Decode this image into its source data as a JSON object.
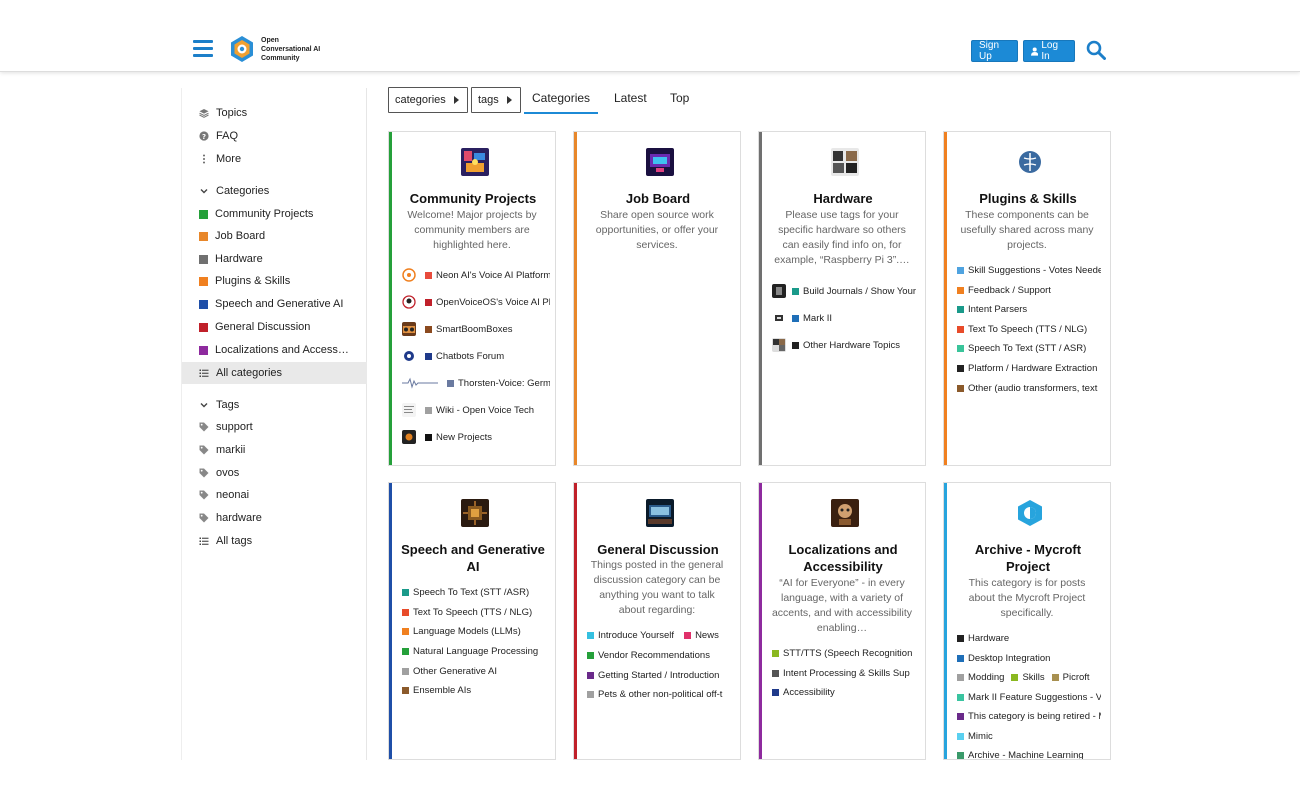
{
  "header": {
    "logo_text": [
      "Open",
      "Conversational AI",
      "Community"
    ],
    "signup_label": "Sign Up",
    "login_label": "Log In"
  },
  "sidebar": {
    "nav": [
      {
        "label": "Topics",
        "icon": "layers-icon"
      },
      {
        "label": "FAQ",
        "icon": "question-icon"
      },
      {
        "label": "More",
        "icon": "ellipsis-vertical-icon"
      }
    ],
    "categories_heading": "Categories",
    "categories": [
      {
        "label": "Community Projects",
        "color": "#25a03a"
      },
      {
        "label": "Job Board",
        "color": "#e8872a"
      },
      {
        "label": "Hardware",
        "color": "#707070"
      },
      {
        "label": "Plugins & Skills",
        "color": "#f08020"
      },
      {
        "label": "Speech and Generative AI",
        "color": "#1f4fa8"
      },
      {
        "label": "General Discussion",
        "color": "#c0202a"
      },
      {
        "label": "Localizations and Accessi…",
        "color": "#8e2a9e"
      }
    ],
    "all_categories": "All categories",
    "tags_heading": "Tags",
    "tags": [
      "support",
      "markii",
      "ovos",
      "neonai",
      "hardware"
    ],
    "all_tags": "All tags"
  },
  "nav": {
    "categories_dropdown": "categories",
    "tags_dropdown": "tags",
    "tabs": [
      "Categories",
      "Latest",
      "Top"
    ]
  },
  "cards": [
    {
      "title": "Community Projects",
      "color": "#25a03a",
      "description": "Welcome! Major projects by community members are highlighted here.",
      "subs": [
        {
          "label": "Neon AI's Voice AI Platform",
          "color": "#e84b3c"
        },
        {
          "label": "OpenVoiceOS's Voice AI Platform",
          "color": "#c0202a"
        },
        {
          "label": "SmartBoomBoxes",
          "color": "#8b4a1f"
        },
        {
          "label": "Chatbots Forum",
          "color": "#1f3a8a"
        },
        {
          "label": "Thorsten-Voice: German",
          "color": "#6a7aa0"
        },
        {
          "label": "Wiki - Open Voice Tech",
          "color": "#a0a0a0"
        },
        {
          "label": "New Projects",
          "color": "#111111"
        }
      ]
    },
    {
      "title": "Job Board",
      "color": "#e8872a",
      "description": "Share open source work opportunities, or offer your services.",
      "subs": []
    },
    {
      "title": "Hardware",
      "color": "#707070",
      "description": "Please use tags for your specific hardware so others can easily find info on, for example, “Raspberry Pi 3”.…",
      "subs": [
        {
          "label": "Build Journals / Show Your",
          "color": "#1a9a8a"
        },
        {
          "label": "Mark II",
          "color": "#1f6fb8"
        },
        {
          "label": "Other Hardware Topics",
          "color": "#222222"
        }
      ]
    },
    {
      "title": "Plugins & Skills",
      "color": "#f08020",
      "description": "These components can be usefully shared across many projects.",
      "subs": [
        {
          "label": "Skill Suggestions - Votes Needed",
          "color": "#4fa3e0"
        },
        {
          "label": "Feedback / Support",
          "color": "#f08020"
        },
        {
          "label": "Intent Parsers",
          "color": "#1a9a8a"
        },
        {
          "label": "Text To Speech (TTS / NLG)",
          "color": "#e84b2a"
        },
        {
          "label": "Speech To Text (STT / ASR)",
          "color": "#3ac49a"
        },
        {
          "label": "Platform / Hardware Extraction",
          "color": "#222222"
        },
        {
          "label": "Other (audio transformers, text",
          "color": "#8b5a2b"
        }
      ]
    },
    {
      "title": "Speech and Generative AI",
      "color": "#1f4fa8",
      "description": "",
      "subs": [
        {
          "label": "Speech To Text (STT /ASR)",
          "color": "#1a9a8a"
        },
        {
          "label": "Text To Speech (TTS / NLG)",
          "color": "#e84b2a"
        },
        {
          "label": "Language Models (LLMs)",
          "color": "#f08020"
        },
        {
          "label": "Natural Language Processing",
          "color": "#25a03a"
        },
        {
          "label": "Other Generative AI",
          "color": "#a0a0a0"
        },
        {
          "label": "Ensemble AIs",
          "color": "#8b5a2b"
        }
      ]
    },
    {
      "title": "General Discussion",
      "color": "#c0202a",
      "description": "Things posted in the general discussion category can be anything you want to talk about regarding:",
      "subs": [
        {
          "label": "Introduce Yourself",
          "color": "#35c0e0"
        },
        {
          "label": "News",
          "color": "#e0306a"
        },
        {
          "label": "Vendor Recommendations",
          "color": "#25a03a"
        },
        {
          "label": "Getting Started / Introduction",
          "color": "#6a2a8a"
        },
        {
          "label": "Pets & other non-political off-t",
          "color": "#a0a0a0"
        }
      ]
    },
    {
      "title": "Localizations and Accessibility",
      "color": "#8e2a9e",
      "description": "“AI for Everyone” - in every language, with a variety of accents, and with accessibility enabling…",
      "subs": [
        {
          "label": "STT/TTS (Speech Recognition",
          "color": "#8ab820"
        },
        {
          "label": "Intent Processing & Skills Sup",
          "color": "#555555"
        },
        {
          "label": "Accessibility",
          "color": "#1f3a8a"
        }
      ]
    },
    {
      "title": "Archive - Mycroft Project",
      "color": "#27a4dd",
      "description": "This category is for posts about the Mycroft Project specifically.",
      "subs": [
        {
          "label": "Hardware",
          "color": "#222222"
        },
        {
          "label": "Desktop Integration",
          "color": "#1f6fb8"
        },
        {
          "label": "Modding",
          "color": "#a0a0a0"
        },
        {
          "label": "Skills",
          "color": "#8ab820"
        },
        {
          "label": "Picroft",
          "color": "#a89050"
        },
        {
          "label": "Mark II Feature Suggestions - Votes",
          "color": "#3ac4a0"
        },
        {
          "label": "This category is being retired - Mycroft",
          "color": "#6a2a8a"
        },
        {
          "label": "Mimic",
          "color": "#5ad0f0"
        },
        {
          "label": "Archive - Machine Learning",
          "color": "#3a9a6a"
        }
      ]
    }
  ]
}
